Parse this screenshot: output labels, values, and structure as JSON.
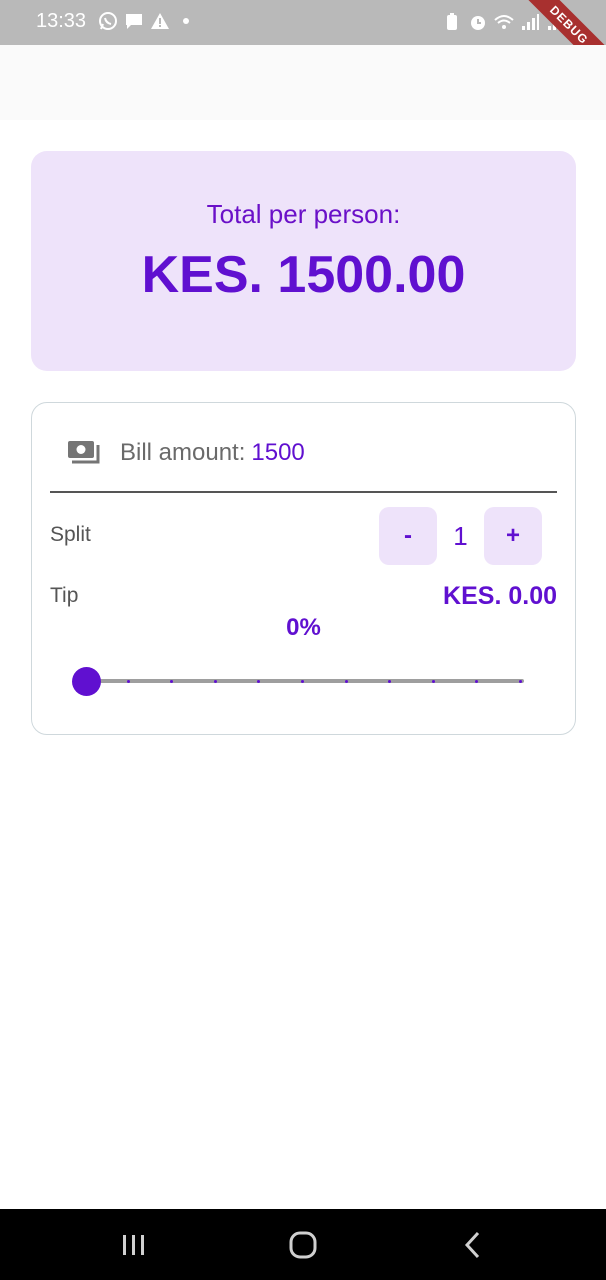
{
  "status_bar": {
    "time": "13:33",
    "left_icons": [
      "whatsapp-icon",
      "message-icon",
      "warning-icon",
      "dot-icon"
    ],
    "right_icons": [
      "battery-saver-icon",
      "alarm-icon",
      "wifi-icon",
      "signal-icon",
      "signal-icon",
      "battery-icon"
    ],
    "debug_banner": "DEBUG"
  },
  "total_card": {
    "label": "Total per person:",
    "value": "KES. 1500.00"
  },
  "bill": {
    "icon": "money-icon",
    "label": "Bill amount:",
    "value": "1500"
  },
  "split": {
    "label": "Split",
    "minus_label": "-",
    "count": "1",
    "plus_label": "+"
  },
  "tip": {
    "label": "Tip",
    "amount": "KES. 0.00",
    "percent_label": "0%",
    "slider_value": 0,
    "slider_divisions": 10
  },
  "nav_bar": {
    "buttons": [
      "recents-icon",
      "home-icon",
      "back-icon"
    ]
  },
  "colors": {
    "accent": "#6010d0",
    "card_background": "#eee3fa",
    "status_bar": "#b9b9b9",
    "debug_banner": "#a8302f"
  }
}
